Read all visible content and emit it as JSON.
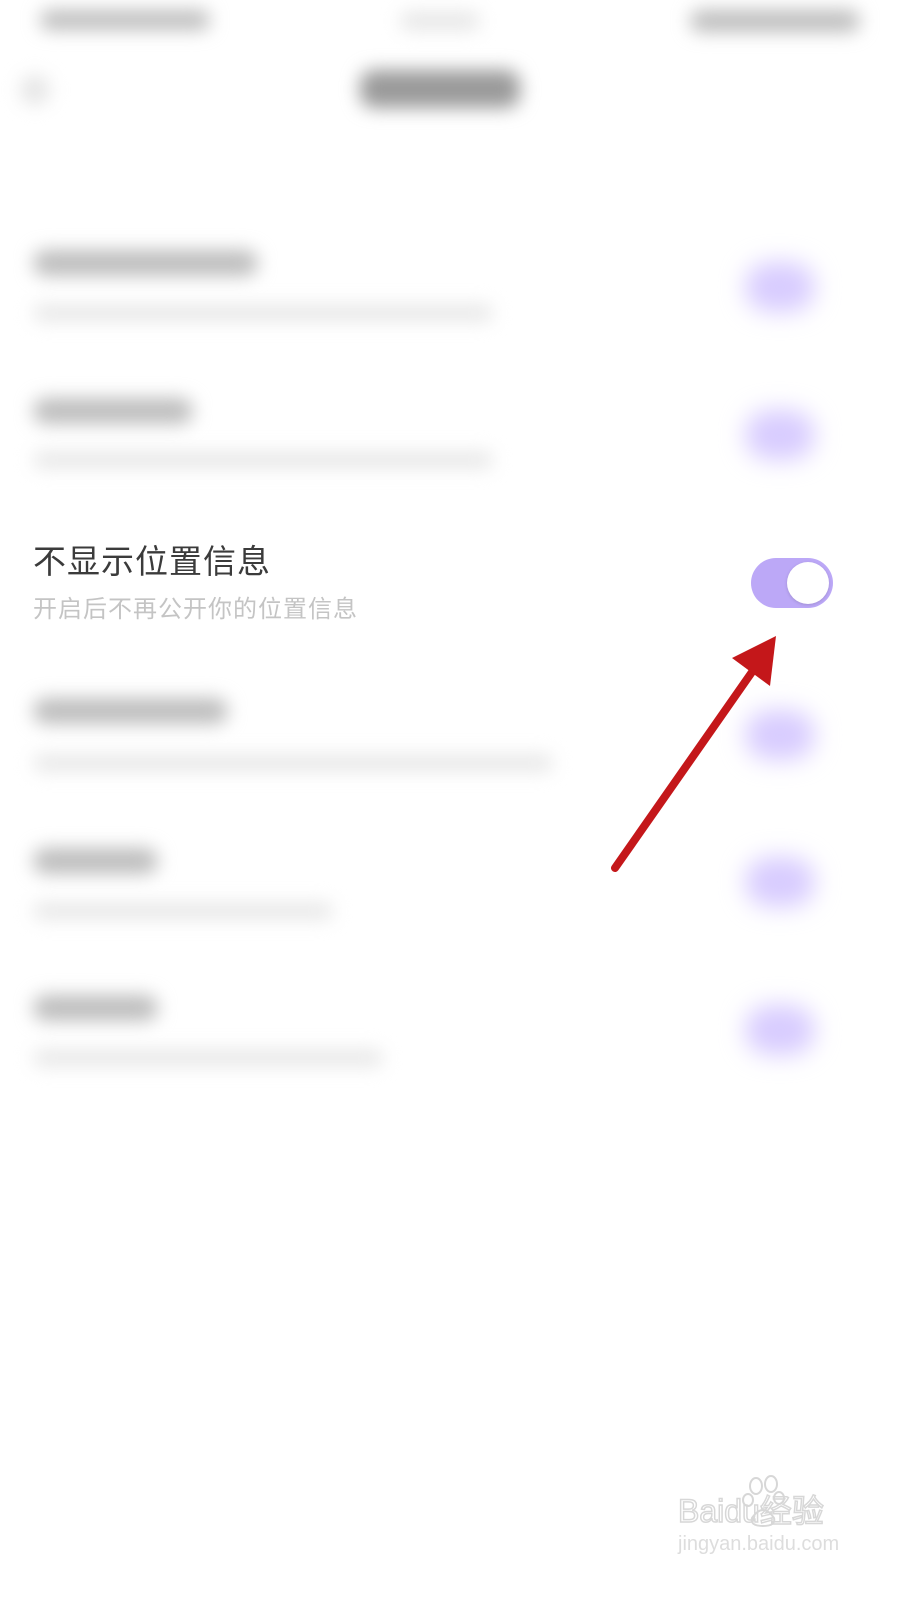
{
  "setting": {
    "title": "不显示位置信息",
    "description": "开启后不再公开你的位置信息",
    "toggle_state": "on"
  },
  "colors": {
    "toggle_on": "#bca8f7",
    "arrow": "#c4171a",
    "title_text": "#3b3b3b",
    "desc_text": "#c4c4c4"
  },
  "watermark": {
    "brand": "Baidu经验",
    "url": "jingyan.baidu.com"
  }
}
